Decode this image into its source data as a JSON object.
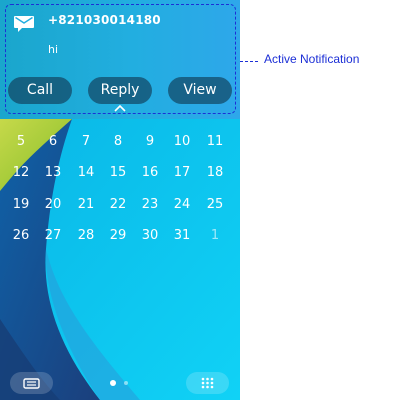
{
  "notification": {
    "sender": "+821030014180",
    "message": "hi",
    "icon": "envelope-icon",
    "buttons": {
      "call": "Call",
      "reply": "Reply",
      "view": "View"
    },
    "handle_icon": "chevron-up-icon"
  },
  "annotation": {
    "label": "Active Notification",
    "color": "#1c2fd6"
  },
  "calendar": {
    "rows": [
      [
        "5",
        "6",
        "7",
        "8",
        "9",
        "10",
        "11"
      ],
      [
        "12",
        "13",
        "14",
        "15",
        "16",
        "17",
        "18"
      ],
      [
        "19",
        "20",
        "21",
        "22",
        "23",
        "24",
        "25"
      ],
      [
        "26",
        "27",
        "28",
        "29",
        "30",
        "31",
        "1"
      ]
    ],
    "highlighted_day": "7",
    "selected_day": "9",
    "next_month_day": "1"
  },
  "dock": {
    "left_icon": "widget-list-icon",
    "right_icon": "app-grid-icon",
    "page_indicator": {
      "pages": 2,
      "current": 1
    }
  },
  "colors": {
    "notification_bg": "#22aee0",
    "button_bg": "#1a4864",
    "wallpaper_cyan": "#08c6ef",
    "wallpaper_green": "#b6d33a",
    "wallpaper_navy": "#1b4e8c"
  }
}
